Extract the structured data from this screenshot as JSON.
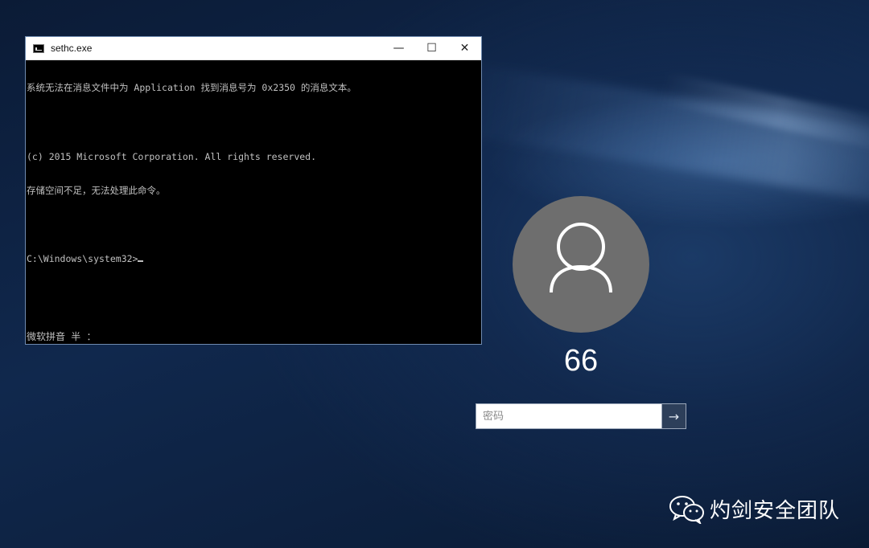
{
  "cmd_window": {
    "title": "sethc.exe",
    "minimize_glyph": "—",
    "maximize_glyph": "☐",
    "close_glyph": "✕",
    "console_lines": [
      "系统无法在消息文件中为 Application 找到消息号为 0x2350 的消息文本。",
      "",
      "(c) 2015 Microsoft Corporation. All rights reserved.",
      "存储空间不足，无法处理此命令。",
      "",
      "C:\\Windows\\system32>"
    ],
    "ime_status": "微软拼音 半 ："
  },
  "login": {
    "username": "66",
    "password_placeholder": "密码",
    "submit_glyph": "→"
  },
  "watermark": {
    "text": "灼剑安全团队"
  },
  "icons": {
    "app": "cmd-icon",
    "avatar": "user-silhouette-icon",
    "submit": "arrow-right-icon",
    "watermark": "wechat-icon"
  }
}
